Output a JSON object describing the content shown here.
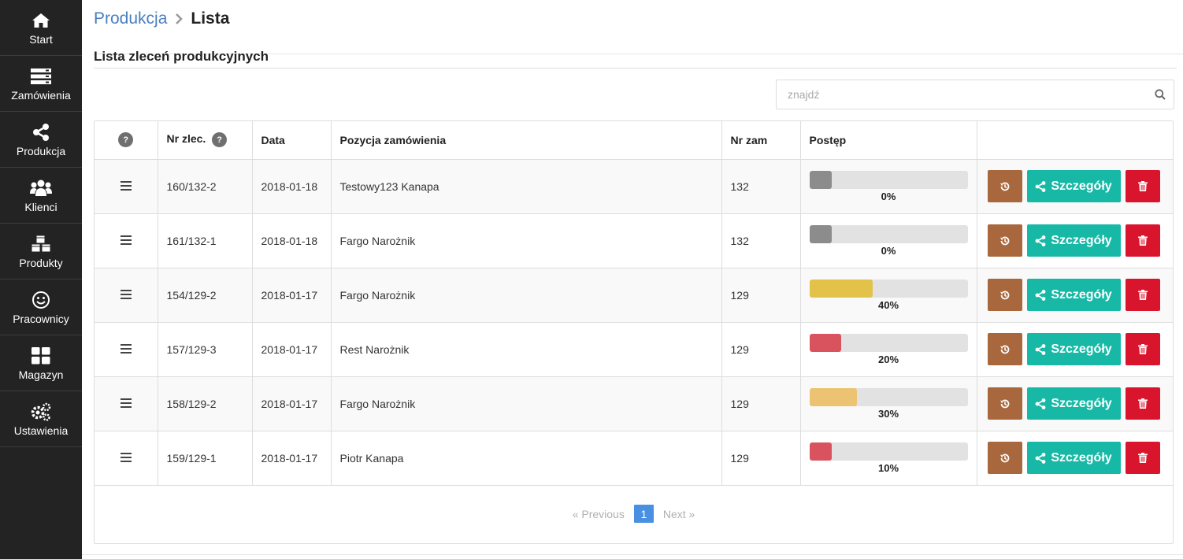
{
  "sidebar": {
    "items": [
      {
        "label": "Start",
        "icon": "home-icon"
      },
      {
        "label": "Zamówienia",
        "icon": "server-icon"
      },
      {
        "label": "Produkcja",
        "icon": "share-icon"
      },
      {
        "label": "Klienci",
        "icon": "users-icon"
      },
      {
        "label": "Produkty",
        "icon": "cubes-icon"
      },
      {
        "label": "Pracownicy",
        "icon": "smile-icon"
      },
      {
        "label": "Magazyn",
        "icon": "grid-icon"
      },
      {
        "label": "Ustawienia",
        "icon": "gears-icon"
      }
    ]
  },
  "breadcrumb": {
    "parent": "Produkcja",
    "current": "Lista"
  },
  "section": {
    "title": "Lista zleceń produkcyjnych"
  },
  "search": {
    "placeholder": "znajdź"
  },
  "table": {
    "headers": {
      "help": "?",
      "nr_zlec": "Nr zlec.",
      "data": "Data",
      "pozycja": "Pozycja zamówienia",
      "nr_zam": "Nr zam",
      "postep": "Postęp"
    },
    "rows": [
      {
        "nr_zlec": "160/132-2",
        "data": "2018-01-18",
        "pozycja": "Testowy123 Kanapa",
        "nr_zam": "132",
        "progress": 0,
        "progress_label": "0%",
        "color": "#8c8c8c"
      },
      {
        "nr_zlec": "161/132-1",
        "data": "2018-01-18",
        "pozycja": "Fargo Narożnik",
        "nr_zam": "132",
        "progress": 0,
        "progress_label": "0%",
        "color": "#8c8c8c"
      },
      {
        "nr_zlec": "154/129-2",
        "data": "2018-01-17",
        "pozycja": "Fargo Narożnik",
        "nr_zam": "129",
        "progress": 40,
        "progress_label": "40%",
        "color": "#e3c24a"
      },
      {
        "nr_zlec": "157/129-3",
        "data": "2018-01-17",
        "pozycja": "Rest Narożnik",
        "nr_zam": "129",
        "progress": 20,
        "progress_label": "20%",
        "color": "#d9535f"
      },
      {
        "nr_zlec": "158/129-2",
        "data": "2018-01-17",
        "pozycja": "Fargo Narożnik",
        "nr_zam": "129",
        "progress": 30,
        "progress_label": "30%",
        "color": "#ebc373"
      },
      {
        "nr_zlec": "159/129-1",
        "data": "2018-01-17",
        "pozycja": "Piotr Kanapa",
        "nr_zam": "129",
        "progress": 10,
        "progress_label": "10%",
        "color": "#d9535f"
      }
    ],
    "details_label": "Szczegóły"
  },
  "pagination": {
    "prev": "« Previous",
    "current": "1",
    "next": "Next »"
  },
  "colors": {
    "sidebar": "#232323",
    "link": "#4a7fc1",
    "history": "#a8673c",
    "details": "#17b9a6",
    "delete": "#d9152e",
    "page_active": "#4a90e2"
  }
}
